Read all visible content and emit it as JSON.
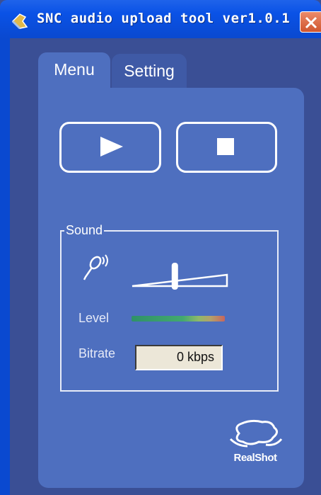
{
  "window": {
    "title": "SNC audio upload tool ver1.0.1"
  },
  "tabs": [
    {
      "label": "Menu",
      "selected": true
    },
    {
      "label": "Setting",
      "selected": false
    }
  ],
  "controls": {
    "play_icon": "play-icon",
    "stop_icon": "stop-icon"
  },
  "sound": {
    "group_label": "Sound",
    "mic_icon": "microphone-icon",
    "volume_level": 0.45,
    "level_label": "Level",
    "level_value": 0.85,
    "bitrate_label": "Bitrate",
    "bitrate_value": "0 kbps"
  },
  "logo": {
    "text": "RealShot"
  },
  "colors": {
    "titlebar": "#0a52e6",
    "panel": "#4e6fbf",
    "background": "#3a4f95",
    "field": "#ece7d8",
    "close_button": "#d0552e"
  }
}
